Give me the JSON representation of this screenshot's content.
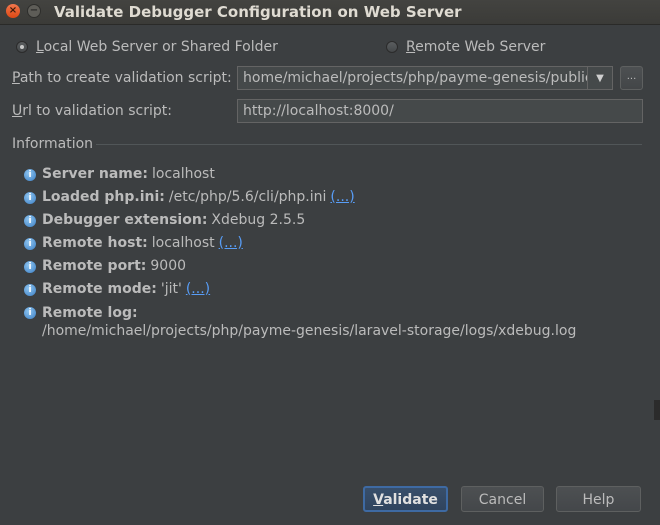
{
  "window": {
    "title": "Validate Debugger Configuration on Web Server",
    "close_glyph": "×",
    "min_glyph": "−"
  },
  "mode": {
    "local_label_prefix": "L",
    "local_label_rest": "ocal Web Server or Shared Folder",
    "local_selected": true,
    "remote_label_prefix": "R",
    "remote_label_rest": "emote Web Server",
    "remote_selected": false
  },
  "path": {
    "label_prefix": "P",
    "label_rest": "ath to create validation script:",
    "value": "home/michael/projects/php/payme-genesis/public",
    "arrow_glyph": "▼",
    "browse_label": "..."
  },
  "url": {
    "label_prefix": "U",
    "label_rest": "rl to validation script:",
    "value": "http://localhost:8000/"
  },
  "information": {
    "title": "Information",
    "icon": "info-icon",
    "items": [
      {
        "key": "Server name:",
        "value": "localhost",
        "link": ""
      },
      {
        "key": "Loaded php.ini:",
        "value": "/etc/php/5.6/cli/php.ini",
        "link": "(...)"
      },
      {
        "key": "Debugger extension:",
        "value": "Xdebug 2.5.5",
        "link": ""
      },
      {
        "key": "Remote host:",
        "value": "localhost",
        "link": "(...)"
      },
      {
        "key": "Remote port:",
        "value": "9000",
        "link": ""
      },
      {
        "key": "Remote mode:",
        "value": "'jit'",
        "link": "(...)"
      },
      {
        "key": "Remote log:",
        "value": "/home/michael/projects/php/payme-genesis/laravel-storage/logs/xdebug.log",
        "link": ""
      }
    ]
  },
  "buttons": {
    "validate_prefix": "V",
    "validate_rest": "alidate",
    "cancel": "Cancel",
    "help": "Help"
  },
  "colors": {
    "background": "#3c3f41",
    "text": "#bbbbbb",
    "link": "#589df6",
    "info_icon": "#3a7ec4",
    "default_button_border": "#3e6aa3"
  }
}
